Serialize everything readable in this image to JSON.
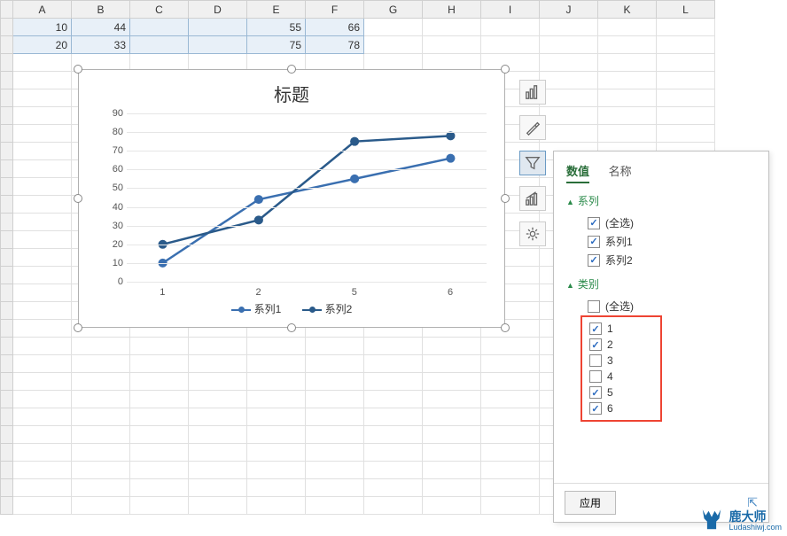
{
  "columns": [
    "A",
    "B",
    "C",
    "D",
    "E",
    "F",
    "G",
    "H",
    "I",
    "J",
    "K",
    "L"
  ],
  "grid_data": {
    "r1": {
      "A": "10",
      "B": "44",
      "E": "55",
      "F": "66"
    },
    "r2": {
      "A": "20",
      "B": "33",
      "E": "75",
      "F": "78"
    }
  },
  "chart": {
    "title": "标题",
    "legend": [
      "系列1",
      "系列2"
    ]
  },
  "chart_data": {
    "type": "line",
    "title": "标题",
    "xlabel": "",
    "ylabel": "",
    "ylim": [
      0,
      90
    ],
    "yticks": [
      0,
      10,
      20,
      30,
      40,
      50,
      60,
      70,
      80,
      90
    ],
    "categories": [
      "1",
      "2",
      "5",
      "6"
    ],
    "series": [
      {
        "name": "系列1",
        "values": [
          10,
          44,
          55,
          66
        ],
        "color": "#3a6fb0"
      },
      {
        "name": "系列2",
        "values": [
          20,
          33,
          75,
          78
        ],
        "color": "#2a5a8a"
      }
    ]
  },
  "side_icons": [
    "chart-elements",
    "brush",
    "funnel",
    "chart-type",
    "gear"
  ],
  "filter": {
    "tab_values": "数值",
    "tab_names": "名称",
    "section_series": "系列",
    "section_category": "类别",
    "series_all": "(全选)",
    "series_items": [
      "系列1",
      "系列2"
    ],
    "cat_all": "(全选)",
    "cat_items": [
      {
        "label": "1",
        "checked": true
      },
      {
        "label": "2",
        "checked": true
      },
      {
        "label": "3",
        "checked": false
      },
      {
        "label": "4",
        "checked": false
      },
      {
        "label": "5",
        "checked": true
      },
      {
        "label": "6",
        "checked": true
      }
    ],
    "apply": "应用"
  },
  "watermark": {
    "main": "鹿大师",
    "sub": "Ludashiwj.com"
  }
}
